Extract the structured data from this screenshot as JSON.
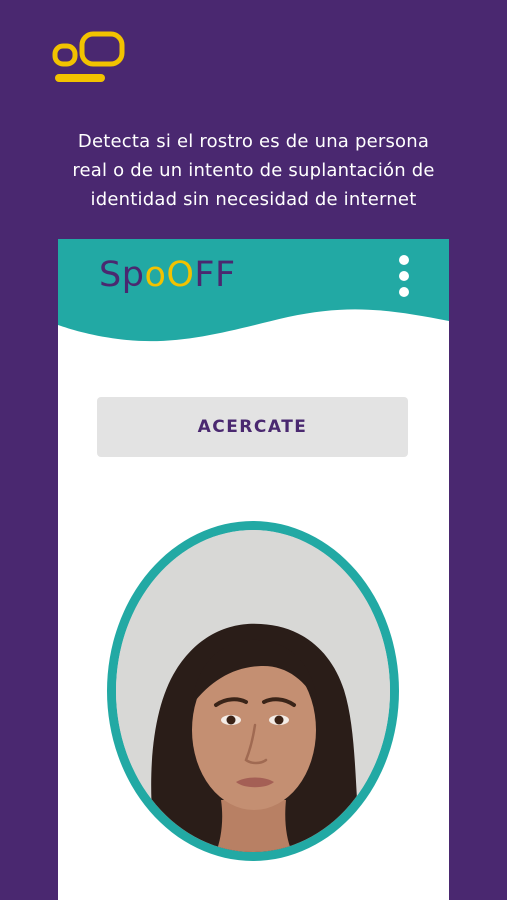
{
  "colors": {
    "background": "#4a2870",
    "accent_yellow": "#f2c200",
    "teal": "#22a9a4",
    "button_bg": "#e3e3e3"
  },
  "brand_logo": {
    "icon": "brand-logo-icon"
  },
  "tagline": {
    "line1": "Detecta si el rostro es de una persona",
    "line2": "real o de un intento de suplantación de",
    "line3": "identidad sin necesidad de internet"
  },
  "app": {
    "logo": {
      "part1": "Sp",
      "part2": "oO",
      "part3": "FF"
    },
    "menu_icon": "more-vertical-icon",
    "action_button_label": "ACERCATE",
    "face_image": "face-photo"
  }
}
